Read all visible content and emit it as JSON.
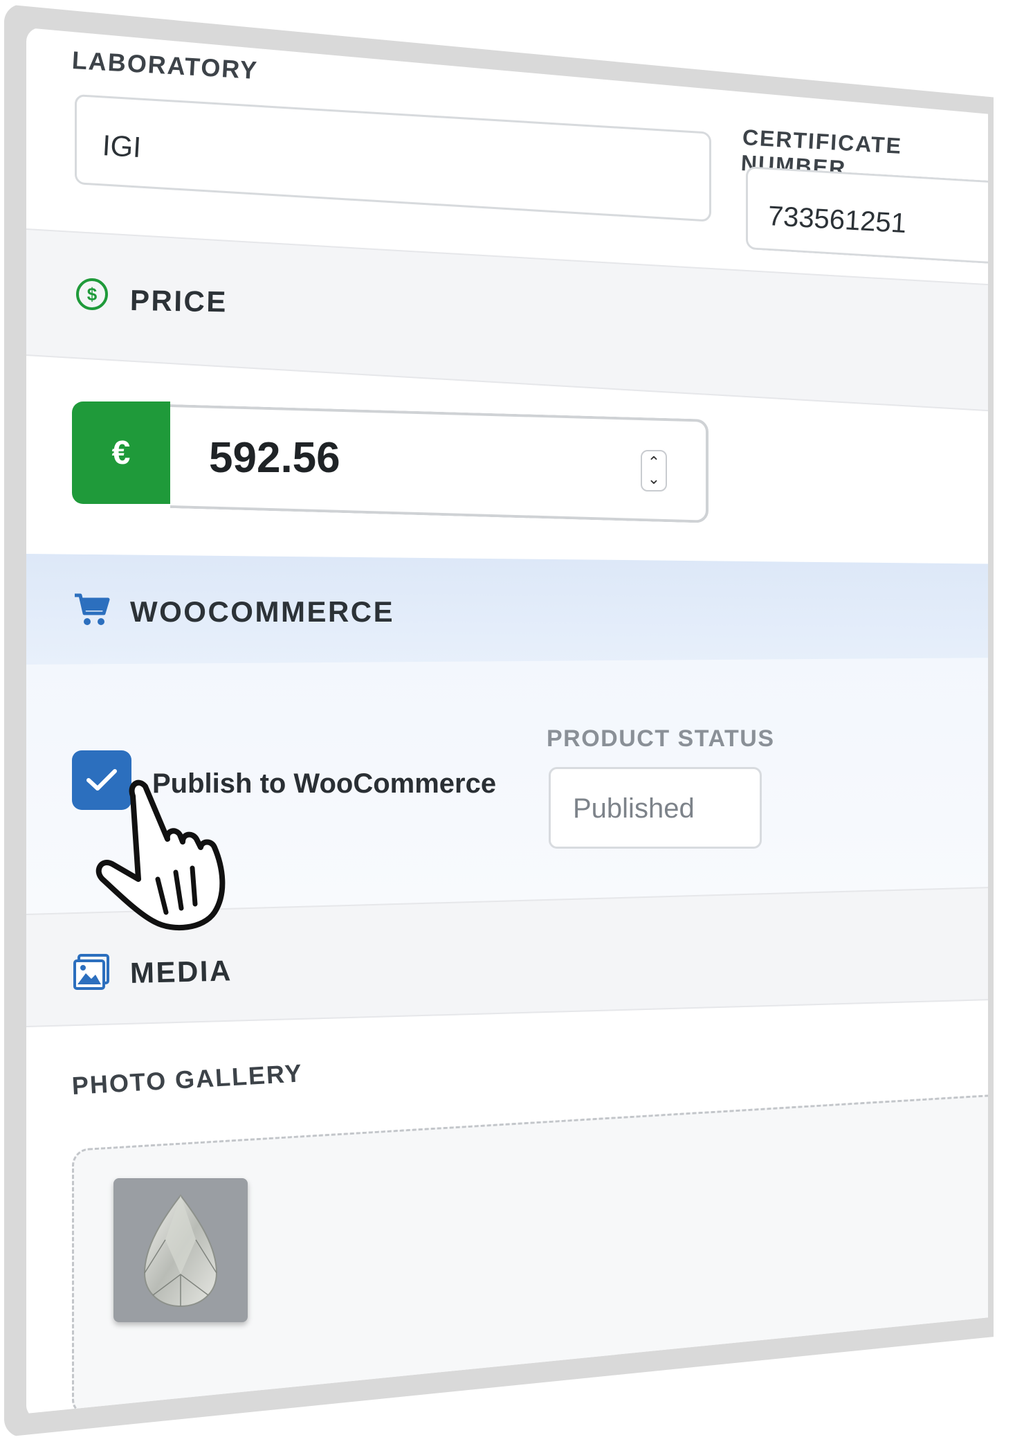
{
  "identification": {
    "laboratory_label": "LABORATORY",
    "laboratory_value": "IGI",
    "certificate_label": "CERTIFICATE NUMBER",
    "certificate_value": "733561251"
  },
  "price": {
    "section_title": "PRICE",
    "currency_symbol": "€",
    "value": "592.56",
    "icon": "dollar-circle-icon"
  },
  "woocommerce": {
    "section_title": "WOOCOMMERCE",
    "icon": "cart-icon",
    "publish_checked": true,
    "publish_label": "Publish to WooCommerce",
    "status_label": "PRODUCT STATUS",
    "status_value": "Published"
  },
  "media": {
    "section_title": "MEDIA",
    "icon": "images-icon",
    "gallery_label": "PHOTO GALLERY",
    "photos": [
      {
        "alt": "pear diamond",
        "icon": "diamond-photo"
      }
    ]
  },
  "colors": {
    "price_addon": "#1f9a3a",
    "checkbox": "#2c6fbe",
    "woocommerce_band": "#dde8f8",
    "accent_border": "#6a9fd8"
  }
}
